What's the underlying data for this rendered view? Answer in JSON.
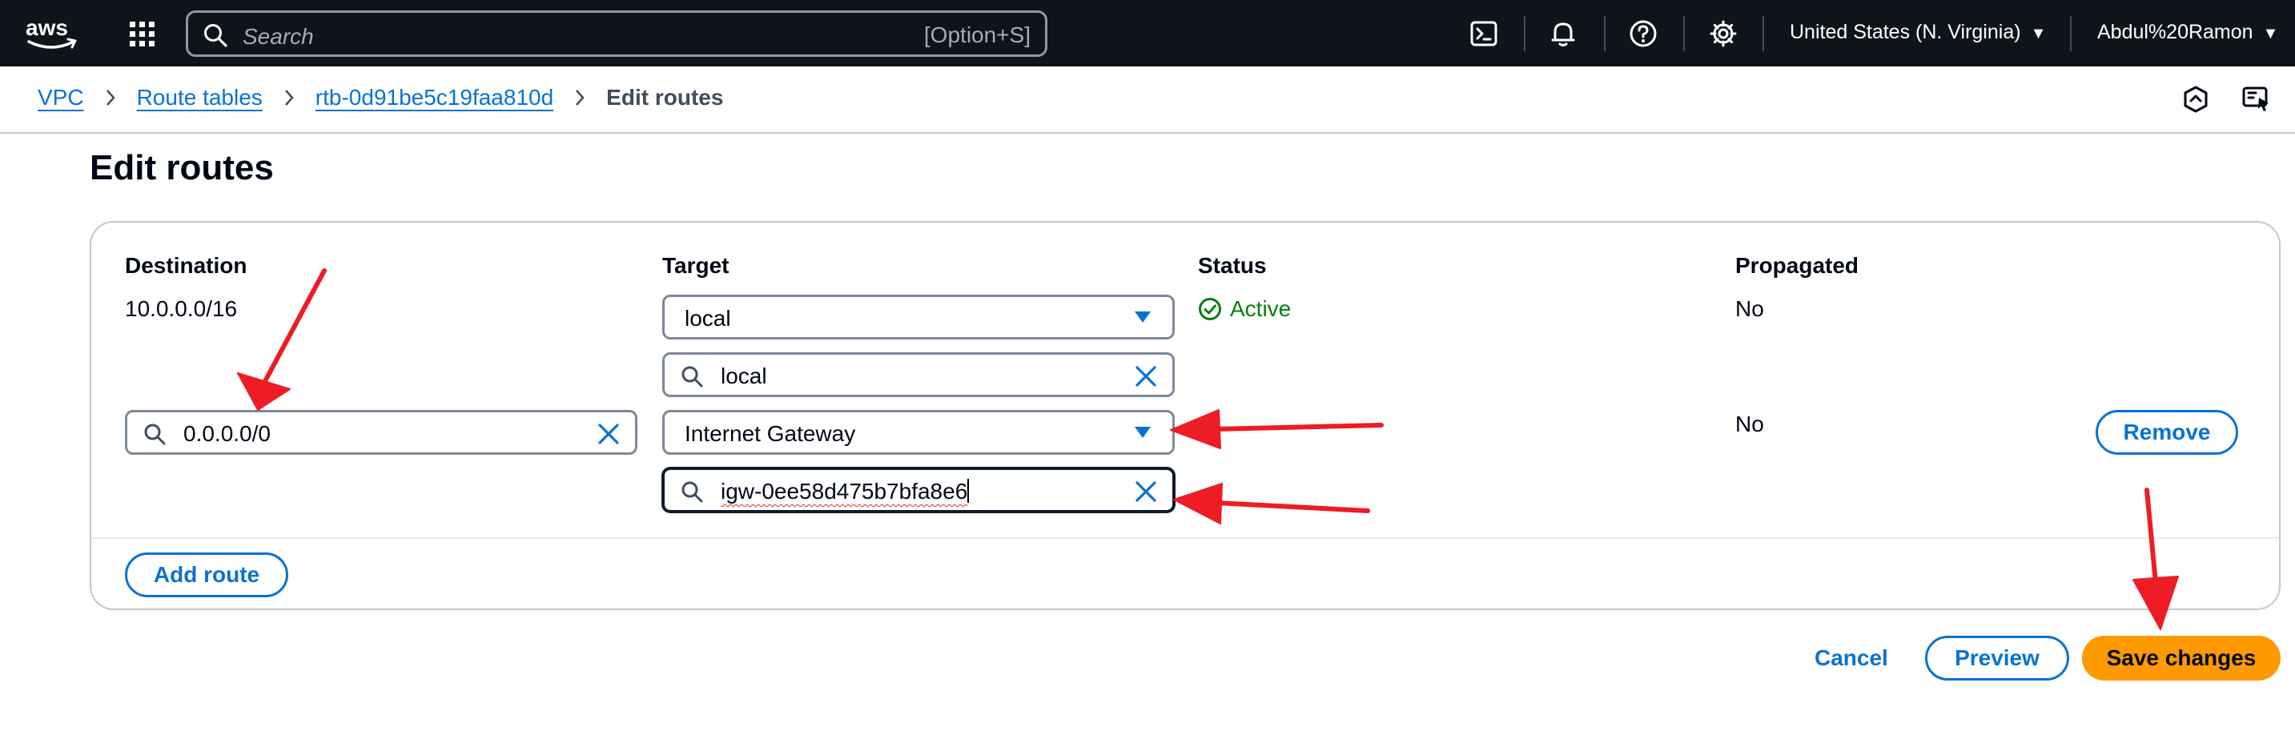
{
  "topbar": {
    "search_placeholder": "Search",
    "search_shortcut": "[Option+S]",
    "region": "United States (N. Virginia)",
    "user": "Abdul%20Ramon",
    "icons": [
      "aws-logo",
      "apps-grid-icon",
      "search-icon",
      "cloudshell-icon",
      "bell-icon",
      "help-icon",
      "settings-icon"
    ]
  },
  "breadcrumb": {
    "items": [
      "VPC",
      "Route tables",
      "rtb-0d91be5c19faa810d"
    ],
    "current": "Edit routes"
  },
  "page": {
    "title": "Edit routes"
  },
  "table": {
    "columns": [
      "Destination",
      "Target",
      "Status",
      "Propagated"
    ],
    "rows": [
      {
        "destination": "10.0.0.0/16",
        "target_type": "local",
        "target_search": "local",
        "status": "Active",
        "propagated": "No"
      },
      {
        "destination": "0.0.0.0/0",
        "target_type": "Internet Gateway",
        "target_search": "igw-0ee58d475b7bfa8e6",
        "propagated": "No",
        "remove_label": "Remove"
      }
    ],
    "add_route_label": "Add route"
  },
  "actions": {
    "cancel": "Cancel",
    "preview": "Preview",
    "save": "Save changes"
  },
  "colors": {
    "link": "#0972d3",
    "primary": "#ff9900",
    "status_ok": "#037f0c",
    "annotation": "#ee1c25"
  }
}
